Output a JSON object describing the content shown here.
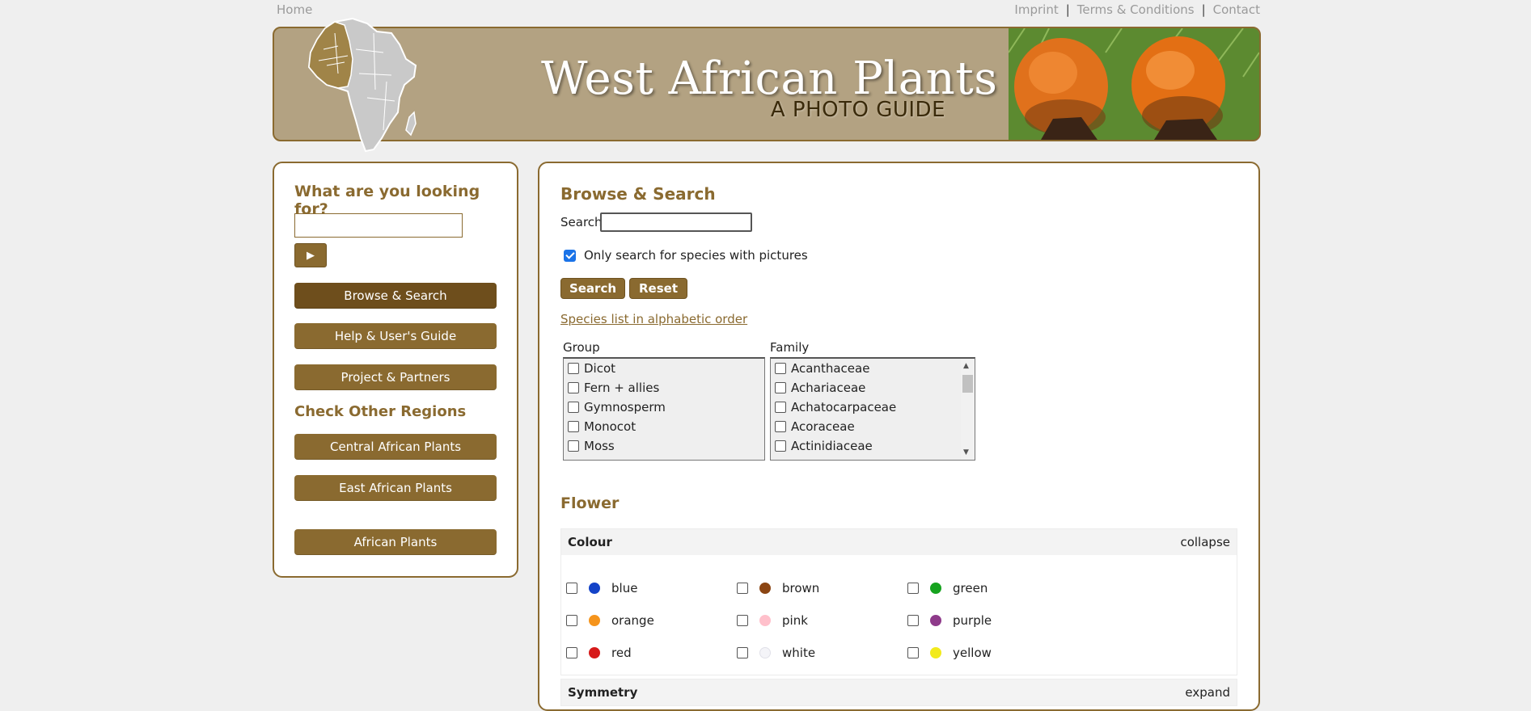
{
  "topnav": {
    "home": "Home",
    "imprint": "Imprint",
    "terms": "Terms & Conditions",
    "contact": "Contact",
    "separator": "|"
  },
  "banner": {
    "title": "West African Plants",
    "subtitle": "A PHOTO GUIDE"
  },
  "sidebar": {
    "heading": "What are you looking for?",
    "go_label": "▶",
    "buttons": {
      "browse": "Browse & Search",
      "help": "Help & User's Guide",
      "project": "Project & Partners"
    },
    "regions_heading": "Check Other Regions",
    "regions": {
      "central": "Central African Plants",
      "east": "East African Plants",
      "african": "African Plants"
    }
  },
  "main": {
    "heading": "Browse & Search",
    "search_label": "Search",
    "only_pictures_label": "Only search for species with pictures",
    "search_button": "Search",
    "reset_button": "Reset",
    "species_link": "Species list in alphabetic order",
    "group": {
      "label": "Group",
      "items": [
        "Dicot",
        "Fern + allies",
        "Gymnosperm",
        "Monocot",
        "Moss"
      ]
    },
    "family": {
      "label": "Family",
      "items": [
        "Acanthaceae",
        "Achariaceae",
        "Achatocarpaceae",
        "Acoraceae",
        "Actinidiaceae"
      ]
    },
    "flower_heading": "Flower",
    "colour_panel": {
      "title": "Colour",
      "toggle": "collapse",
      "colours": [
        {
          "name": "blue",
          "color": "#1443c8"
        },
        {
          "name": "brown",
          "color": "#8b4513"
        },
        {
          "name": "green",
          "color": "#16a31f"
        },
        {
          "name": "orange",
          "color": "#f5941c"
        },
        {
          "name": "pink",
          "color": "#ffc0cb"
        },
        {
          "name": "purple",
          "color": "#8e3a8a"
        },
        {
          "name": "red",
          "color": "#d61a1a"
        },
        {
          "name": "white",
          "color": "#f4f4f8"
        },
        {
          "name": "yellow",
          "color": "#f2ea1c"
        }
      ]
    },
    "symmetry_panel": {
      "title": "Symmetry",
      "toggle": "expand"
    }
  },
  "colors": {
    "accent": "#8a6a30",
    "accent_dark": "#6e4e1c",
    "banner_bg": "#b3a282"
  }
}
